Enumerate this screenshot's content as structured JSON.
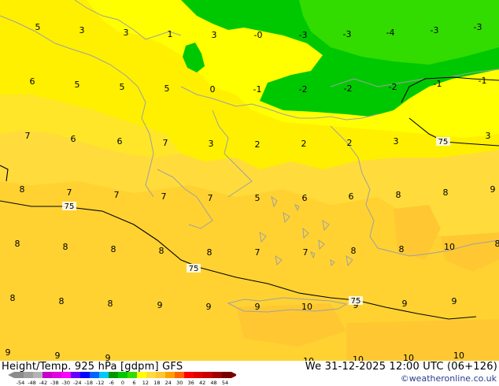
{
  "header": {
    "title": "Height/Temp. 925 hPa [gdpm] GFS",
    "datetime": "We 31-12-2025 12:00 UTC (06+126)",
    "credit": "©weatheronline.co.uk"
  },
  "colors": {
    "green_dark": "#00c800",
    "green_light": "#32dc00",
    "yellow_bright": "#ffff00",
    "yellow": "#fff000",
    "yellow_orange": "#ffdc3c",
    "orange_light": "#ffd232",
    "orange": "#ffc832",
    "coastline": "#a0a0a0",
    "contour": "#000000"
  },
  "temperature_labels": [
    {
      "text": "5"
    },
    {
      "text": "3"
    },
    {
      "text": "3"
    },
    {
      "text": "1"
    },
    {
      "text": "3"
    },
    {
      "text": "-0"
    },
    {
      "text": "-3"
    },
    {
      "text": "-3"
    },
    {
      "text": "-4"
    },
    {
      "text": "-3"
    },
    {
      "text": "-3"
    },
    {
      "text": "6"
    },
    {
      "text": "5"
    },
    {
      "text": "5"
    },
    {
      "text": "5"
    },
    {
      "text": "0"
    },
    {
      "text": "-1"
    },
    {
      "text": "-2"
    },
    {
      "text": "-2"
    },
    {
      "text": "-2"
    },
    {
      "text": "-1"
    },
    {
      "text": "-1"
    },
    {
      "text": "7"
    },
    {
      "text": "6"
    },
    {
      "text": "6"
    },
    {
      "text": "7"
    },
    {
      "text": "3"
    },
    {
      "text": "2"
    },
    {
      "text": "2"
    },
    {
      "text": "2"
    },
    {
      "text": "3"
    },
    {
      "text": "3"
    },
    {
      "text": "8"
    },
    {
      "text": "7"
    },
    {
      "text": "7"
    },
    {
      "text": "7"
    },
    {
      "text": "7"
    },
    {
      "text": "5"
    },
    {
      "text": "6"
    },
    {
      "text": "6"
    },
    {
      "text": "8"
    },
    {
      "text": "8"
    },
    {
      "text": "9"
    },
    {
      "text": "8"
    },
    {
      "text": "8"
    },
    {
      "text": "8"
    },
    {
      "text": "8"
    },
    {
      "text": "8"
    },
    {
      "text": "7"
    },
    {
      "text": "7"
    },
    {
      "text": "8"
    },
    {
      "text": "8"
    },
    {
      "text": "10"
    },
    {
      "text": "8"
    },
    {
      "text": "8"
    },
    {
      "text": "8"
    },
    {
      "text": "8"
    },
    {
      "text": "9"
    },
    {
      "text": "9"
    },
    {
      "text": "9"
    },
    {
      "text": "10"
    },
    {
      "text": "9"
    },
    {
      "text": "9"
    },
    {
      "text": "9"
    },
    {
      "text": "9"
    },
    {
      "text": "9"
    },
    {
      "text": "9"
    },
    {
      "text": "10"
    },
    {
      "text": "10"
    },
    {
      "text": "10"
    },
    {
      "text": "10"
    }
  ],
  "contour_labels": [
    {
      "text": "75"
    },
    {
      "text": "75"
    },
    {
      "text": "75"
    },
    {
      "text": "75"
    }
  ],
  "color_scale": {
    "ticks": [
      "-54",
      "-48",
      "-42",
      "-38",
      "-30",
      "-24",
      "-18",
      "-12",
      "-6",
      "0",
      "6",
      "12",
      "18",
      "24",
      "30",
      "36",
      "42",
      "48",
      "54"
    ],
    "colors": [
      "#8c8c8c",
      "#a0a0a0",
      "#b4b4b4",
      "#c800c8",
      "#e100e1",
      "#ff00ff",
      "#6400ff",
      "#0000ff",
      "#0064ff",
      "#00c8ff",
      "#009600",
      "#00c800",
      "#32dc00",
      "#ffff00",
      "#ffdc3c",
      "#ffc832",
      "#ffa000",
      "#ff6400",
      "#ff0000",
      "#e10000",
      "#c80000",
      "#a00000",
      "#780000"
    ]
  }
}
